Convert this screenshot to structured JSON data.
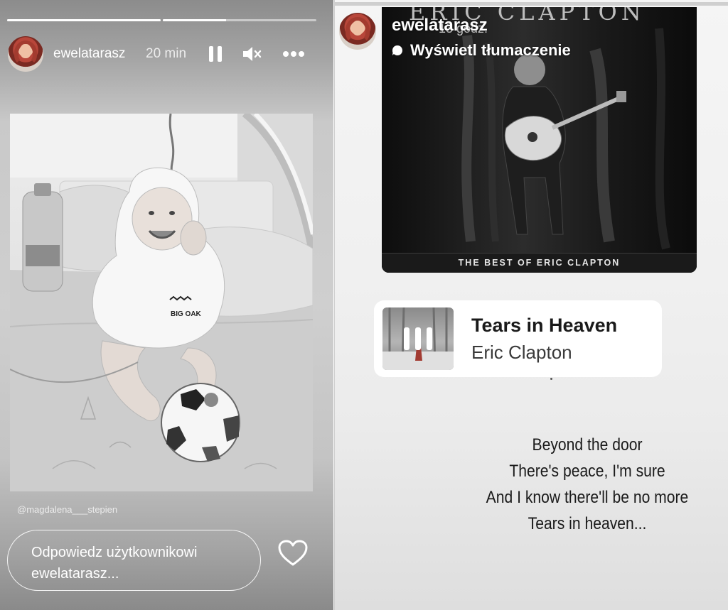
{
  "left_story": {
    "progress": [
      1.0,
      0.41
    ],
    "username": "ewelatarasz",
    "time": "20 min",
    "icons": {
      "pause": "pause-icon",
      "mute": "mute-icon",
      "more": "more-options-icon",
      "like": "heart-icon"
    },
    "photo": {
      "hoodie_text": "BIG OAK"
    },
    "mention": "@magdalena___stepien",
    "reply_placeholder": "Odpowiedz użytkownikowi ewelatarasz..."
  },
  "right_story": {
    "username": "ewelatarasz",
    "time_overlay": "13 godz.",
    "translate_label": "Wyświetl tłumaczenie",
    "album": {
      "artist_text": "ERIC CLAPTON",
      "subtitle": "THE BEST OF ERIC CLAPTON"
    },
    "music": {
      "title": "Tears in Heaven",
      "artist": "Eric Clapton"
    },
    "lyrics": [
      "Beyond the door",
      "There's peace, I'm sure",
      "And I know there'll be no more",
      "Tears in heaven..."
    ]
  },
  "colors": {
    "story_text": "#ffffff",
    "dark_text": "#1a1a1a"
  }
}
